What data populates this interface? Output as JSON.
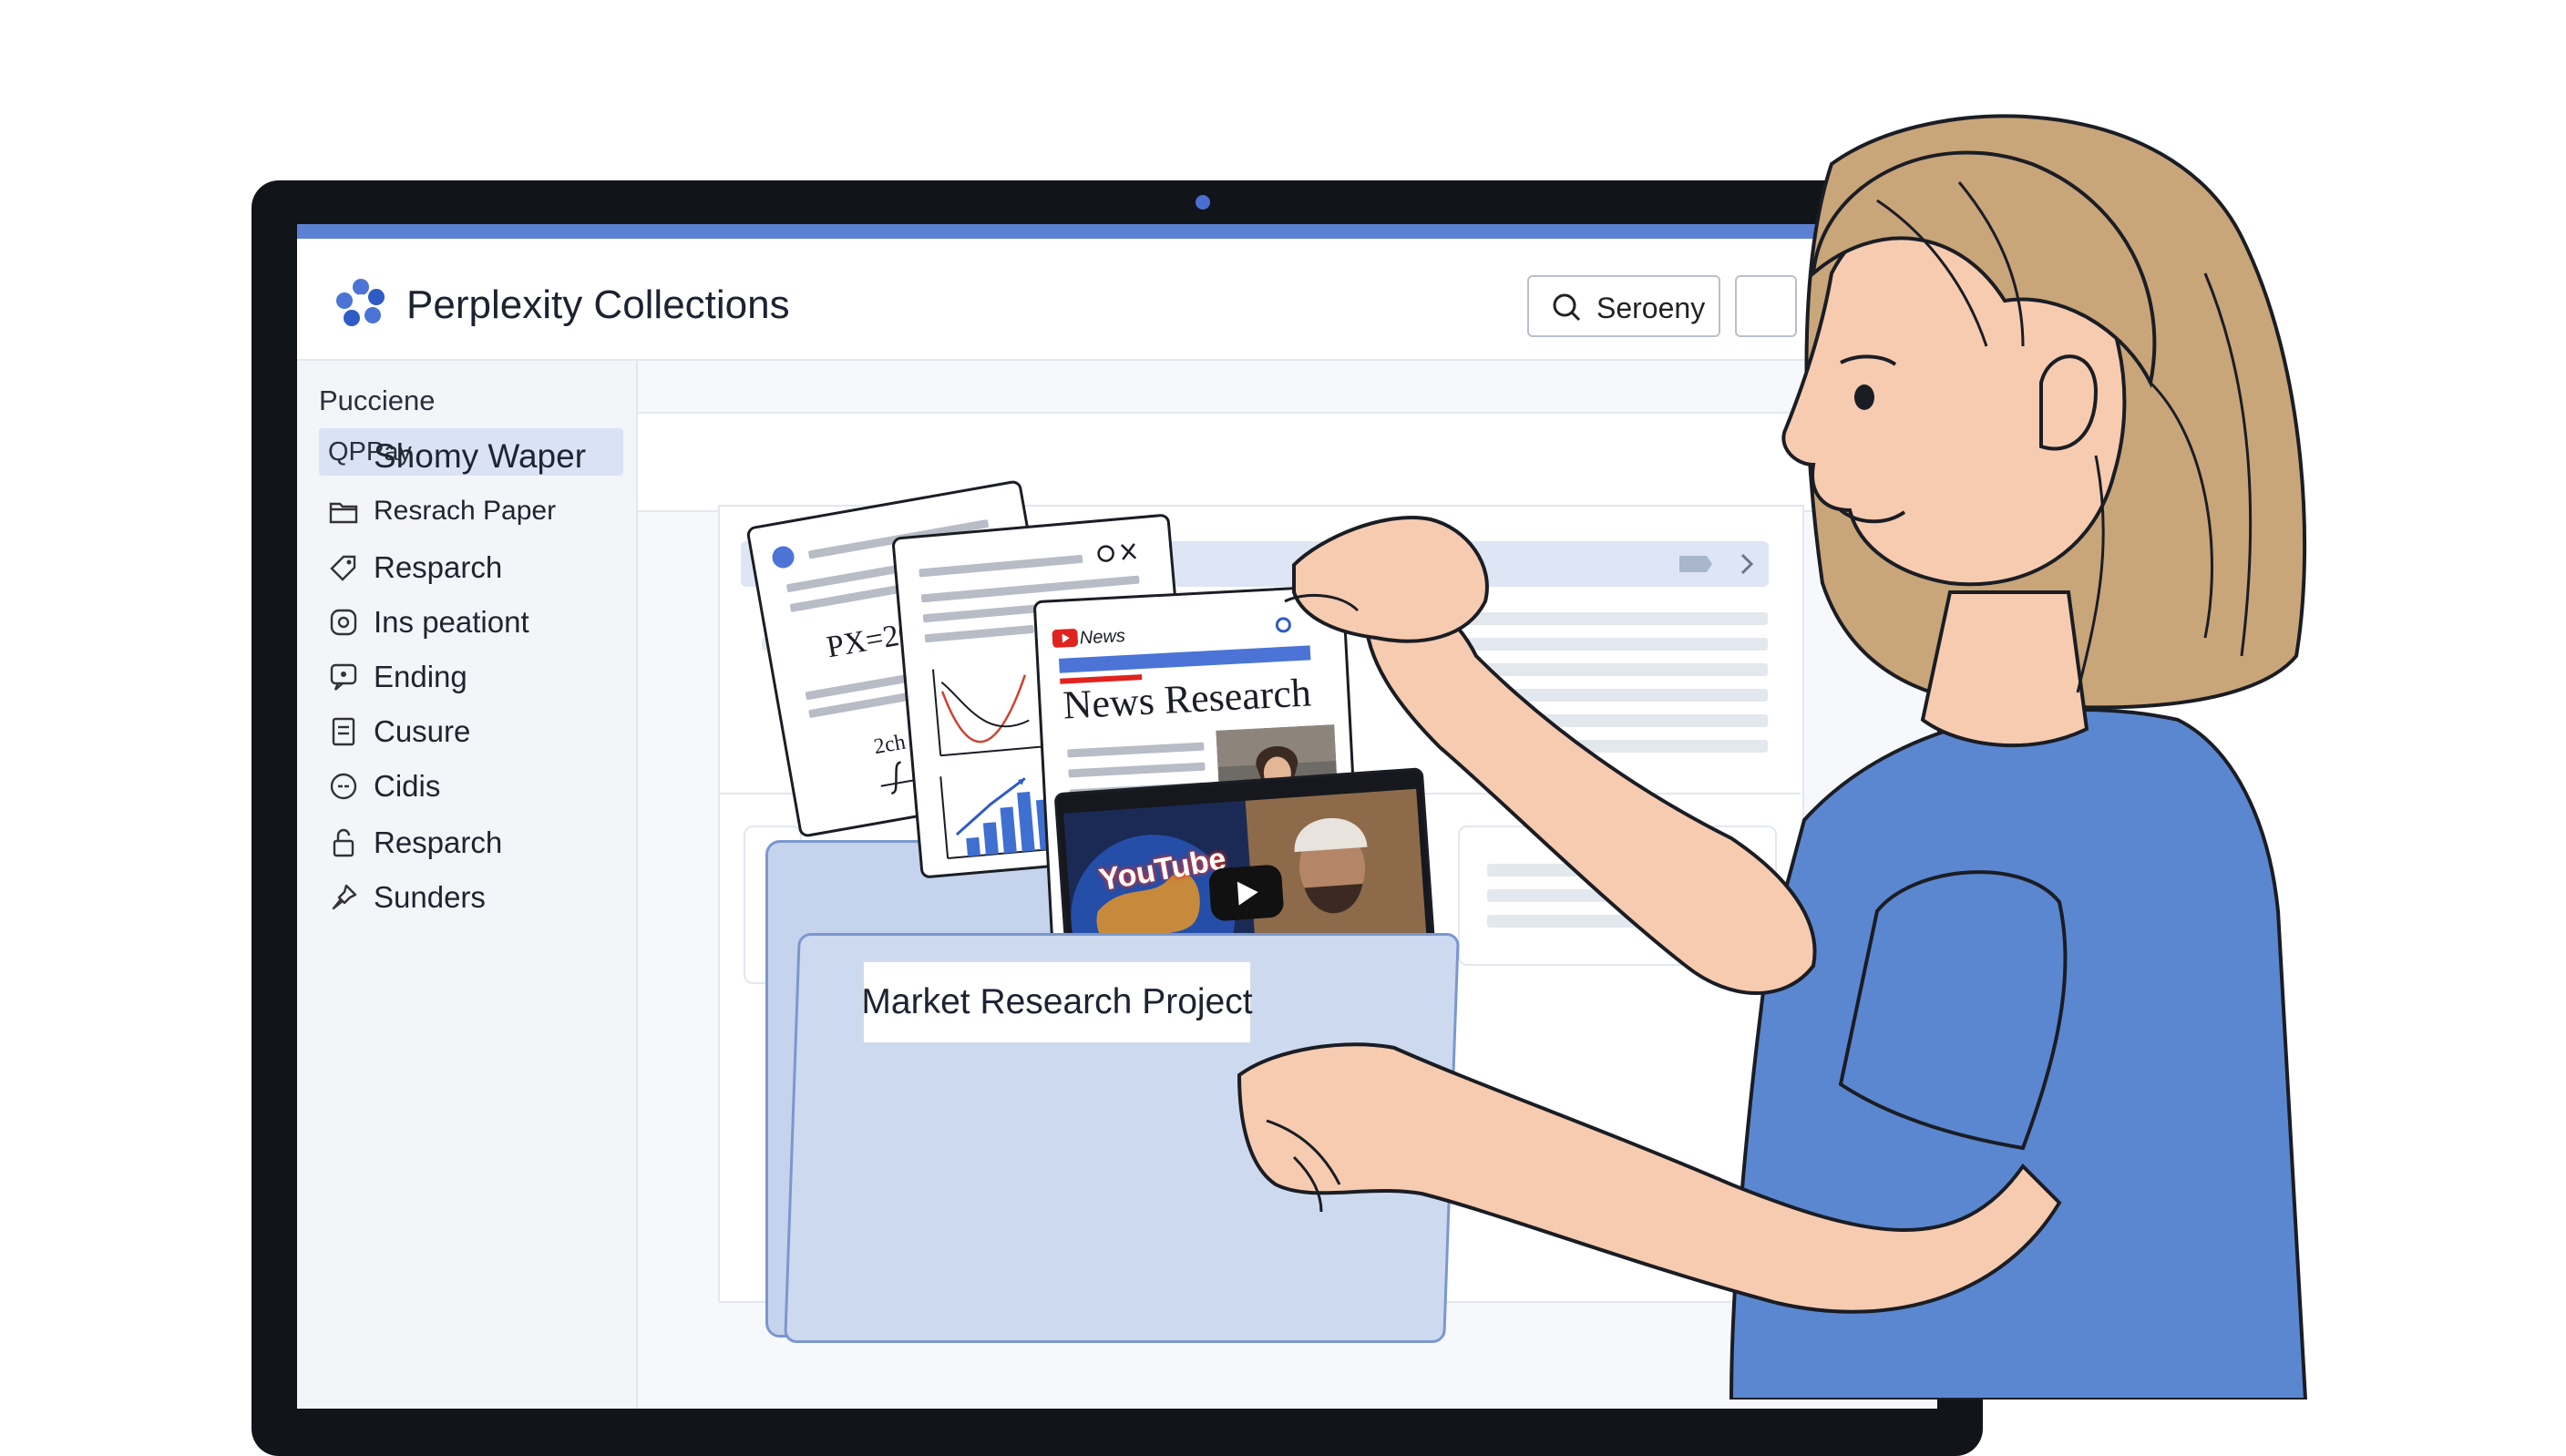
{
  "app": {
    "title": "Perplexity Collections",
    "search_label": "Seroeny"
  },
  "sidebar": {
    "heading": "Pucciene",
    "search_text": "QPPay",
    "items": [
      {
        "label": "Resrach Paper",
        "icon": "folder-icon"
      },
      {
        "label": "Resparch",
        "icon": "tag-icon"
      },
      {
        "label": "Ins peationt",
        "icon": "settings-icon"
      },
      {
        "label": "Ending",
        "icon": "chat-icon"
      },
      {
        "label": "Cusure",
        "icon": "document-icon"
      },
      {
        "label": "Cidis",
        "icon": "link-icon"
      },
      {
        "label": "Resparch",
        "icon": "lock-icon"
      },
      {
        "label": "Sunders",
        "icon": "pin-icon"
      }
    ]
  },
  "main": {
    "title": "Shomy Waper"
  },
  "cards": {
    "formula": "PX=20",
    "formula2": "2ch",
    "news_tag": "News",
    "news_title": "News Research",
    "video_brand": "YouTube"
  },
  "folder": {
    "label": "Market Research Project"
  },
  "colors": {
    "accent": "#5b80d4",
    "folder": "#c6d3ec",
    "shirt": "#5b87d0",
    "hair": "#c9a57a",
    "skin": "#f7cbb0"
  }
}
